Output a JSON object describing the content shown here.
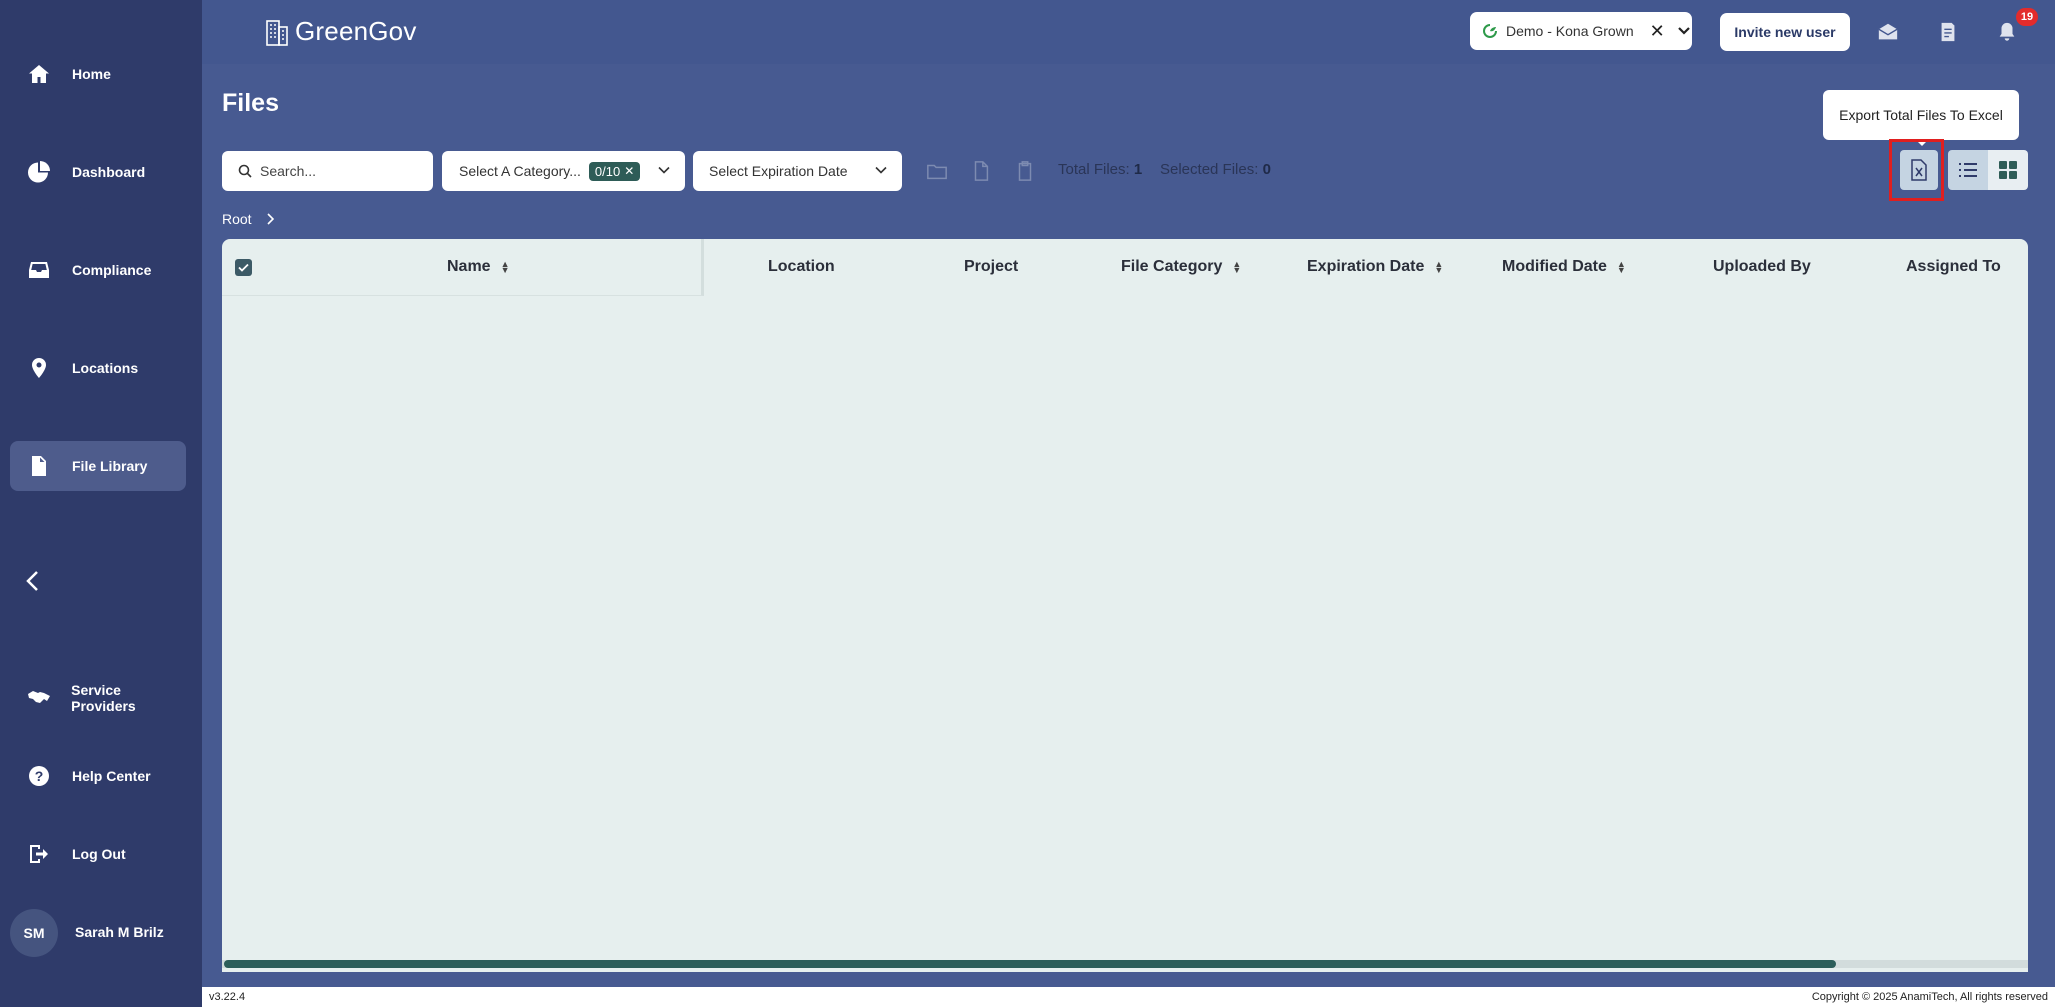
{
  "sidebar": {
    "items": [
      {
        "label": "Home",
        "icon": "home-icon"
      },
      {
        "label": "Dashboard",
        "icon": "pie-chart-icon"
      },
      {
        "label": "Compliance",
        "icon": "inbox-tray-icon"
      },
      {
        "label": "Locations",
        "icon": "map-pin-icon"
      },
      {
        "label": "File Library",
        "icon": "file-icon",
        "active": true
      },
      {
        "label": "Service Providers",
        "icon": "handshake-icon"
      },
      {
        "label": "Help Center",
        "icon": "question-circle-icon"
      },
      {
        "label": "Log Out",
        "icon": "logout-icon"
      }
    ],
    "user": {
      "initials": "SM",
      "name": "Sarah M Brilz"
    }
  },
  "header": {
    "brand": "GreenGov",
    "org_selector": {
      "value": "Demo - Kona Grown"
    },
    "invite_label": "Invite new user",
    "notification_count": "19"
  },
  "page": {
    "title": "Files",
    "search_placeholder": "Search...",
    "category_placeholder": "Select A Category...",
    "category_count": "0/10",
    "expiration_placeholder": "Select Expiration Date",
    "total_files_label": "Total Files:",
    "total_files_value": "1",
    "selected_files_label": "Selected Files:",
    "selected_files_value": "0",
    "tooltip": "Export Total Files To Excel",
    "breadcrumb_root": "Root",
    "columns": [
      "Name",
      "Location",
      "Project",
      "File Category",
      "Expiration Date",
      "Modified Date",
      "Uploaded By",
      "Assigned To"
    ]
  },
  "footer": {
    "version": "v3.22.4",
    "copyright": "Copyright © 2025 AnamiTech, All rights reserved"
  },
  "colors": {
    "sidebar": "#2f3b6a",
    "main": "#475a91",
    "table": "#e6efee",
    "accent": "#2c5e5a",
    "highlight": "#e01f1f"
  }
}
